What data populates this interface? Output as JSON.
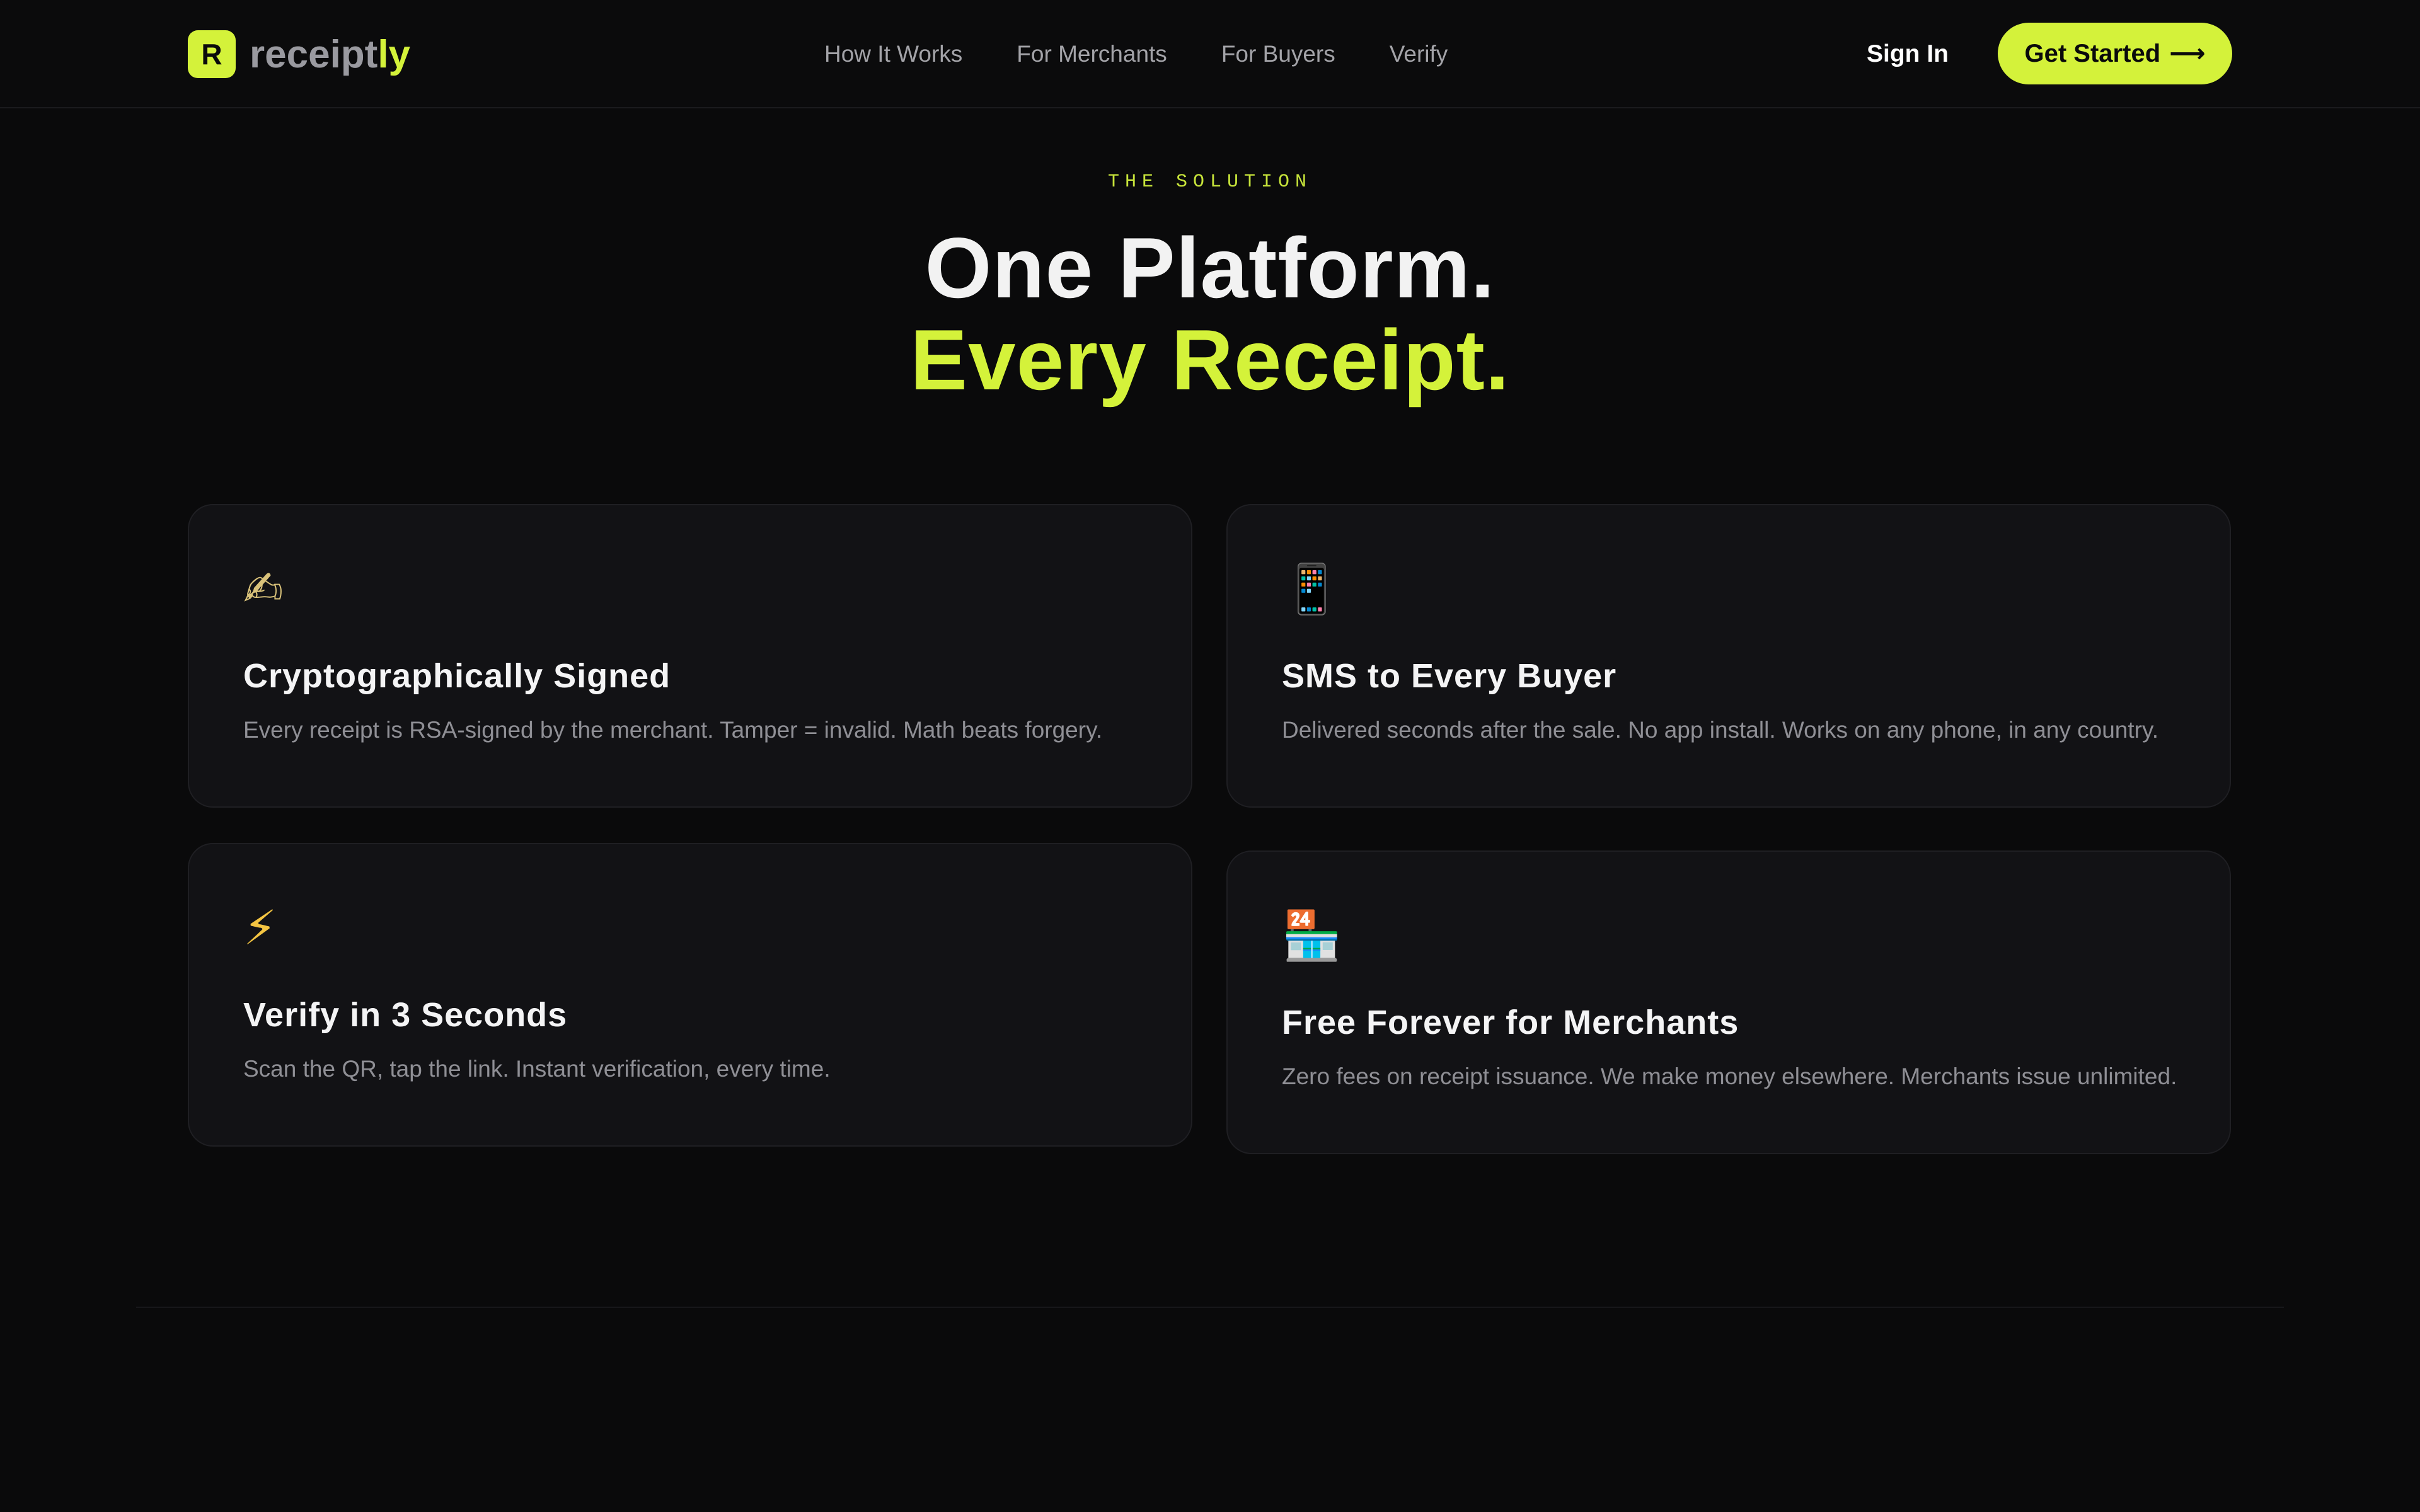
{
  "nav": {
    "logo_mark": "R",
    "logo_text_main": "receipt",
    "logo_text_accent": "ly",
    "links": [
      "How It Works",
      "For Merchants",
      "For Buyers",
      "Verify"
    ],
    "signin_label": "Sign In",
    "cta_label": "Get Started",
    "cta_arrow": "⟶"
  },
  "hero": {
    "eyebrow": "THE SOLUTION",
    "line1": "One Platform.",
    "line2": "Every Receipt."
  },
  "features": [
    {
      "icon": "signature-pen-icon",
      "glyph": "✍",
      "title": "Cryptographically Signed",
      "desc": "Every receipt is RSA-signed by the merchant. Tamper = invalid. Math beats forgery."
    },
    {
      "icon": "mobile-phone-icon",
      "glyph": "📱",
      "title": "SMS to Every Buyer",
      "desc": "Delivered seconds after the sale. No app install. Works on any phone, in any country."
    },
    {
      "icon": "lightning-bolt-icon",
      "glyph": "⚡",
      "title": "Verify in 3 Seconds",
      "desc": "Scan the QR, tap the link. Instant verification, every time."
    },
    {
      "icon": "convenience-store-icon",
      "glyph": "🏪",
      "title": "Free Forever for Merchants",
      "desc": "Zero fees on receipt issuance. We make money elsewhere. Merchants issue unlimited."
    }
  ],
  "colors": {
    "accent": "#d4f23a",
    "background": "#0a0a0b",
    "card": "#121215"
  }
}
